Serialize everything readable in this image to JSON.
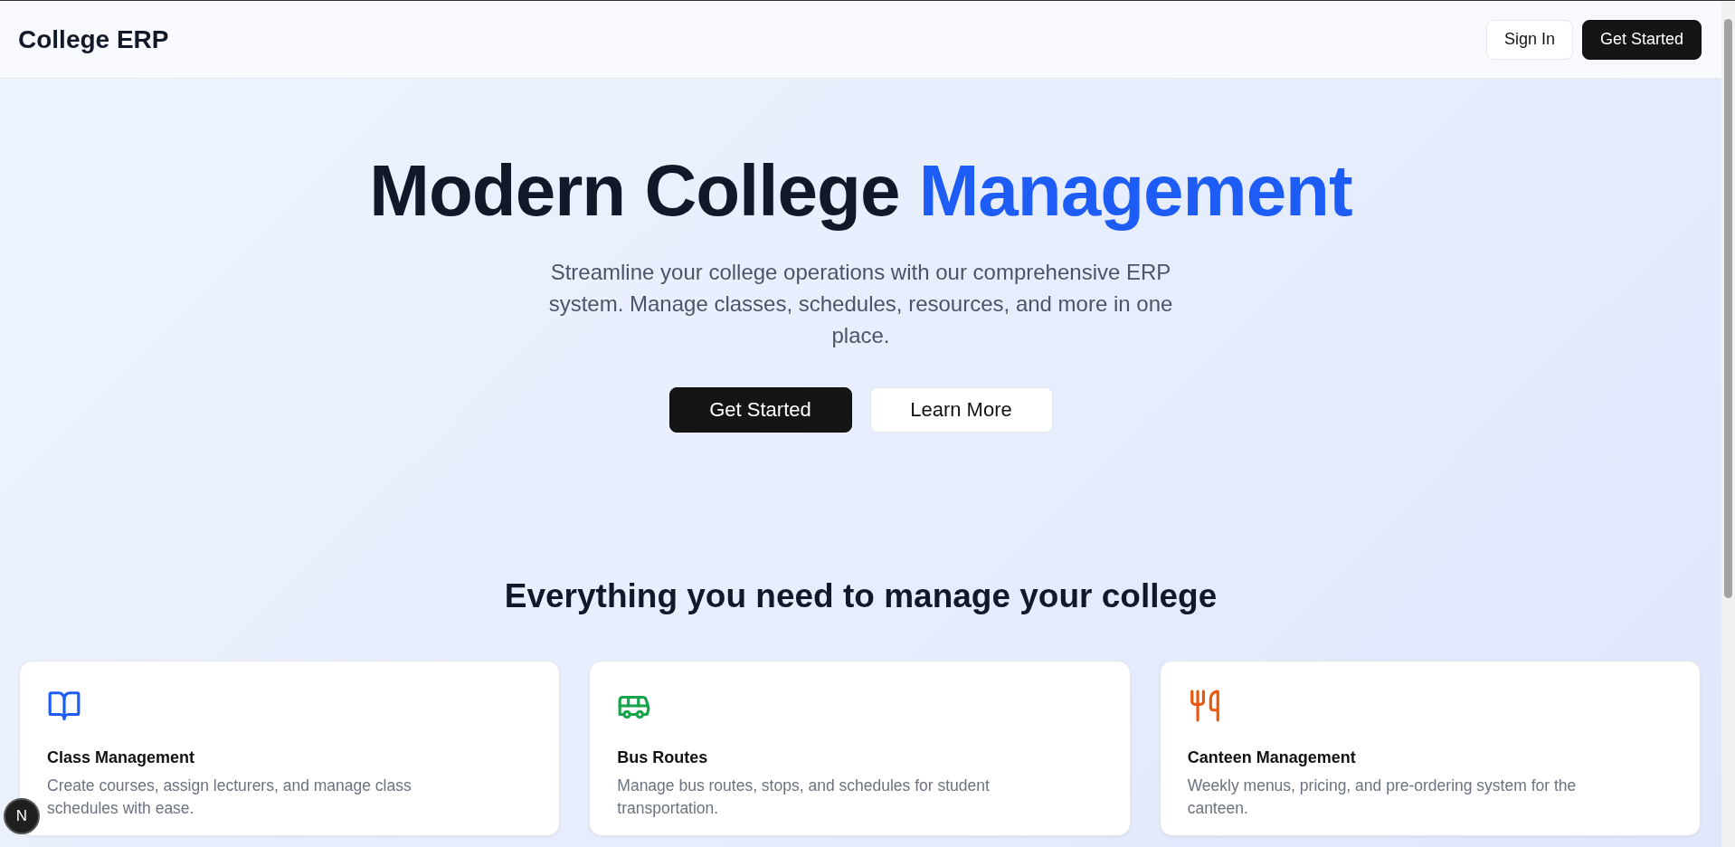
{
  "header": {
    "brand": "College ERP",
    "buttons": [
      {
        "label": "Sign In",
        "kind": "outline"
      },
      {
        "label": "Get Started",
        "kind": "solid"
      }
    ]
  },
  "hero": {
    "title": "Modern College",
    "title_highlight": "Management",
    "subtitle": "Streamline your college operations with our comprehensive ERP system. Manage classes, schedules, resources, and more in one place.",
    "buttons": [
      {
        "label": "Get Started",
        "kind": "solid"
      },
      {
        "label": "Learn More",
        "kind": "outline"
      }
    ]
  },
  "features": {
    "heading": "Everything you need to manage your college",
    "cards": [
      {
        "kind": "book",
        "color": "#1d5cf5",
        "title": "Class Management",
        "description": "Create courses, assign lecturers, and manage class schedules with ease."
      },
      {
        "kind": "bus",
        "color": "#16a34a",
        "title": "Bus Routes",
        "description": "Manage bus routes, stops, and schedules for student transportation."
      },
      {
        "kind": "utensils",
        "color": "#ea580c",
        "title": "Canteen Management",
        "description": "Weekly menus, pricing, and pre-ordering system for the canteen."
      }
    ]
  },
  "dev_badge": {
    "label": "N"
  }
}
